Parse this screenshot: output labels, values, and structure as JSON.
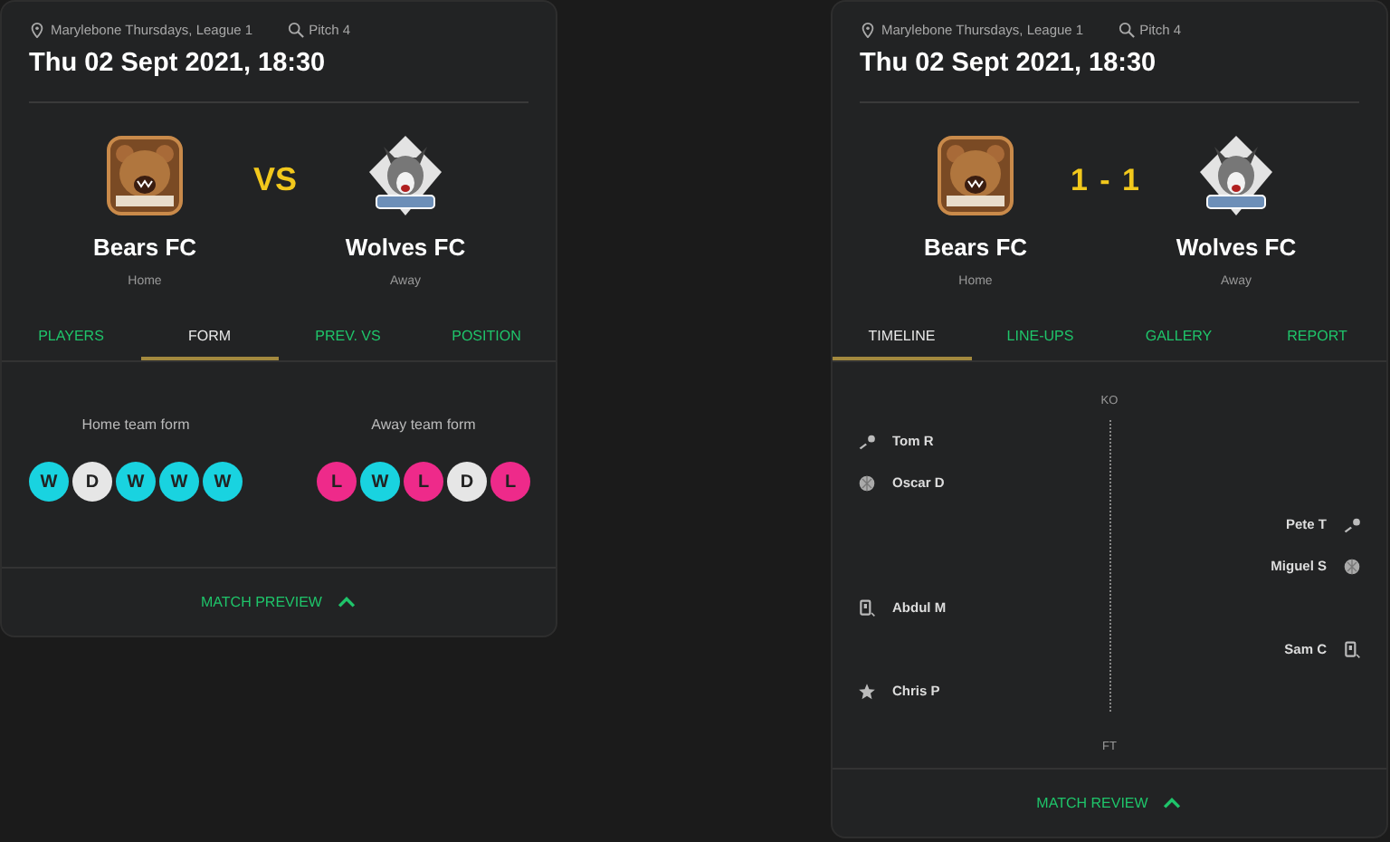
{
  "cards": [
    {
      "location": "Marylebone Thursdays, League 1",
      "pitch": "Pitch 4",
      "datetime": "Thu 02 Sept 2021, 18:30",
      "home": {
        "name": "Bears FC",
        "role": "Home"
      },
      "away": {
        "name": "Wolves FC",
        "role": "Away"
      },
      "centre": {
        "kind": "vs",
        "text": "VS"
      },
      "tabs": [
        {
          "label": "PLAYERS",
          "selected": false
        },
        {
          "label": "FORM",
          "selected": true
        },
        {
          "label": "PREV. VS",
          "selected": false
        },
        {
          "label": "POSITION",
          "selected": false
        }
      ],
      "content": {
        "kind": "form",
        "teams": [
          {
            "label": "Home team form",
            "results": [
              {
                "text": "W",
                "color": "#19d3e0"
              },
              {
                "text": "D",
                "color": "#e6e6e6"
              },
              {
                "text": "W",
                "color": "#19d3e0"
              },
              {
                "text": "W",
                "color": "#19d3e0"
              },
              {
                "text": "W",
                "color": "#19d3e0"
              }
            ]
          },
          {
            "label": "Away team form",
            "results": [
              {
                "text": "L",
                "color": "#ee2a8a"
              },
              {
                "text": "W",
                "color": "#19d3e0"
              },
              {
                "text": "L",
                "color": "#ee2a8a"
              },
              {
                "text": "D",
                "color": "#e6e6e6"
              },
              {
                "text": "L",
                "color": "#ee2a8a"
              }
            ]
          }
        ]
      },
      "footer": "MATCH PREVIEW"
    },
    {
      "location": "Marylebone Thursdays, League 1",
      "pitch": "Pitch 4",
      "datetime": "Thu 02 Sept 2021, 18:30",
      "home": {
        "name": "Bears FC",
        "role": "Home"
      },
      "away": {
        "name": "Wolves FC",
        "role": "Away"
      },
      "centre": {
        "kind": "score",
        "text": "1 - 1"
      },
      "tabs": [
        {
          "label": "TIMELINE",
          "selected": true
        },
        {
          "label": "LINE-UPS",
          "selected": false
        },
        {
          "label": "GALLERY",
          "selected": false
        },
        {
          "label": "REPORT",
          "selected": false
        }
      ],
      "content": {
        "kind": "timeline",
        "start": "KO",
        "end": "FT",
        "events": [
          {
            "home": {
              "kind": "assist",
              "name": "Tom R"
            }
          },
          {
            "home": {
              "kind": "goal",
              "name": "Oscar D"
            }
          },
          {
            "away": {
              "kind": "assist",
              "name": "Pete T"
            }
          },
          {
            "away": {
              "kind": "goal",
              "name": "Miguel S"
            }
          },
          {
            "home": {
              "kind": "card",
              "name": "Abdul M"
            }
          },
          {
            "away": {
              "kind": "card",
              "name": "Sam C"
            }
          },
          {
            "home": {
              "kind": "star",
              "name": "Chris P"
            }
          }
        ]
      },
      "footer": "MATCH REVIEW"
    }
  ]
}
